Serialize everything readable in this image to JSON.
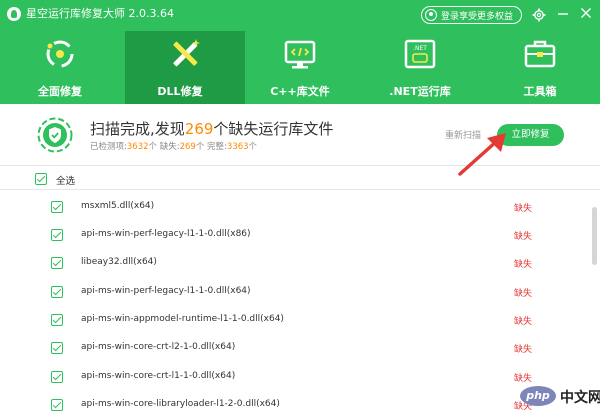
{
  "app": {
    "title": "星空运行库修复大师 2.0.3.64",
    "login_label": "登录享受更多权益"
  },
  "nav": {
    "tabs": [
      {
        "label": "全面修复",
        "icon": "full-repair-icon",
        "active": false
      },
      {
        "label": "DLL修复",
        "icon": "dll-repair-icon",
        "active": true
      },
      {
        "label": "C++库文件",
        "icon": "cpp-library-icon",
        "active": false
      },
      {
        "label": ".NET运行库",
        "icon": "dotnet-runtime-icon",
        "active": false
      },
      {
        "label": "工具箱",
        "icon": "toolbox-icon",
        "active": false
      }
    ],
    "net_badge": ".NET"
  },
  "summary": {
    "headline_pre": "扫描完成,发现",
    "headline_count": "269",
    "headline_post": "个缺失运行库文件",
    "checked_label": "已检测项:",
    "checked_count": "3632",
    "missing_label": "个   缺失:",
    "missing_count": "269",
    "complete_label": "个   完整:",
    "complete_count": "3363",
    "unit": "个",
    "rescan_label": "重新扫描",
    "fix_label": "立即修复"
  },
  "list": {
    "select_all_label": "全选",
    "select_all_checked": true,
    "rows": [
      {
        "name": "msxml5.dll(x64)",
        "status": "缺失",
        "checked": true
      },
      {
        "name": "api-ms-win-perf-legacy-l1-1-0.dll(x86)",
        "status": "缺失",
        "checked": true
      },
      {
        "name": "libeay32.dll(x64)",
        "status": "缺失",
        "checked": true
      },
      {
        "name": "api-ms-win-perf-legacy-l1-1-0.dll(x64)",
        "status": "缺失",
        "checked": true
      },
      {
        "name": "api-ms-win-appmodel-runtime-l1-1-0.dll(x64)",
        "status": "缺失",
        "checked": true
      },
      {
        "name": "api-ms-win-core-crt-l2-1-0.dll(x64)",
        "status": "缺失",
        "checked": true
      },
      {
        "name": "api-ms-win-core-crt-l1-1-0.dll(x64)",
        "status": "缺失",
        "checked": true
      },
      {
        "name": "api-ms-win-core-libraryloader-l1-2-0.dll(x64)",
        "status": "缺失",
        "checked": true
      }
    ]
  },
  "watermark": {
    "badge": "php",
    "site": "中文网"
  },
  "colors": {
    "brand_green": "#2fbf5c",
    "active_tab": "#1f9a45",
    "highlight_orange": "#ff8a00",
    "missing_red": "#e53935",
    "annotation_arrow": "#e53935"
  }
}
